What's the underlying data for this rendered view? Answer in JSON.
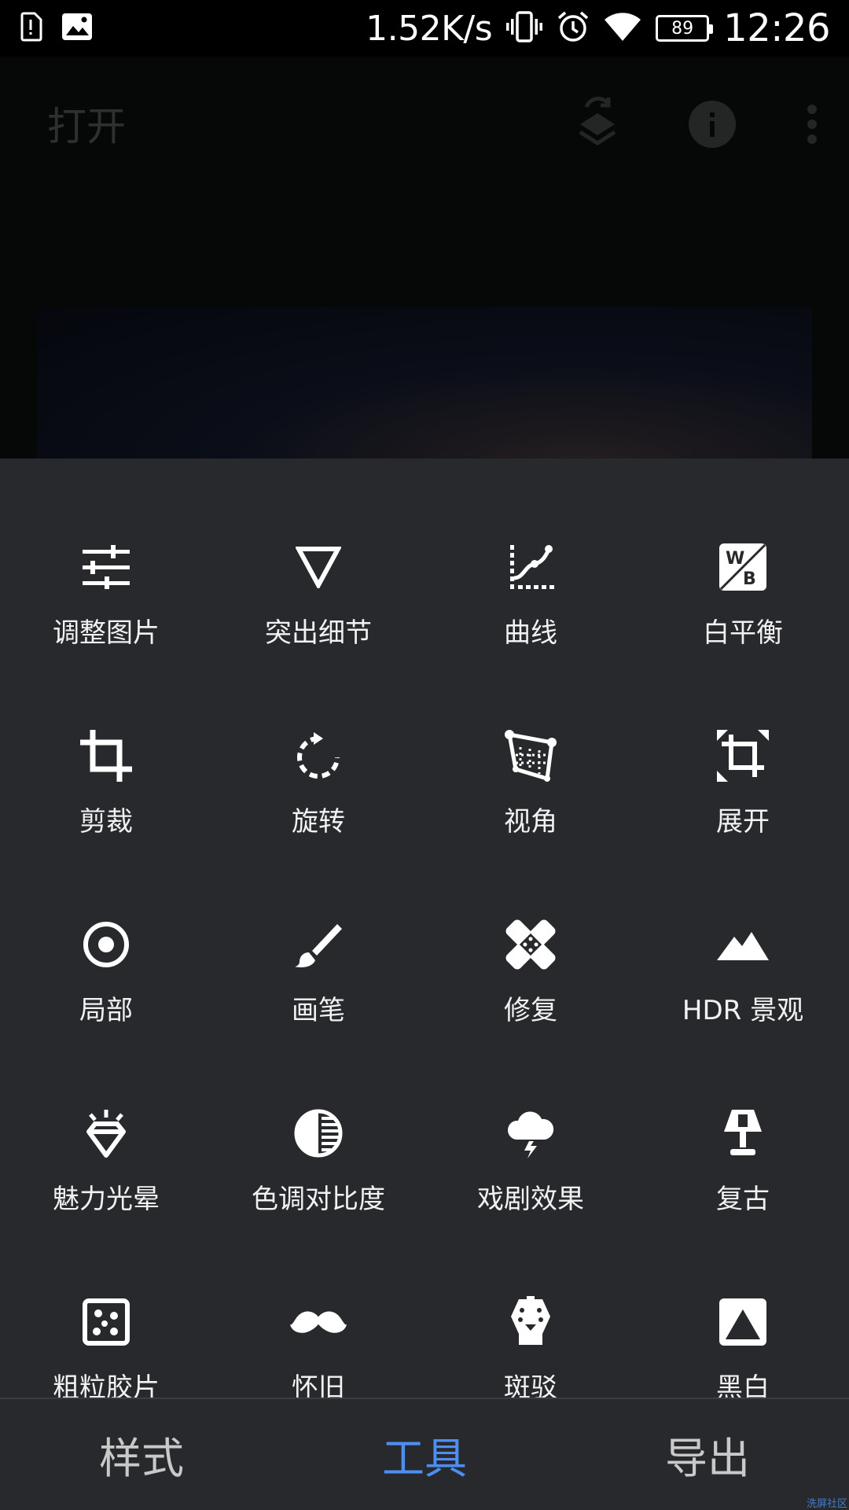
{
  "status_bar": {
    "net_speed": "1.52K/s",
    "battery": "89",
    "time": "12:26",
    "icons": [
      "alert-icon",
      "image-icon",
      "vibrate-icon",
      "alarm-icon",
      "wifi-icon",
      "battery-icon"
    ]
  },
  "app_bar": {
    "title": "打开",
    "actions": [
      "layers-undo-icon",
      "info-icon",
      "more-vert-icon"
    ]
  },
  "tools": [
    {
      "label": "调整图片",
      "icon": "tune-icon"
    },
    {
      "label": "突出细节",
      "icon": "details-triangle-icon"
    },
    {
      "label": "曲线",
      "icon": "curves-icon"
    },
    {
      "label": "白平衡",
      "icon": "white-balance-icon"
    },
    {
      "label": "剪裁",
      "icon": "crop-icon"
    },
    {
      "label": "旋转",
      "icon": "rotate-icon"
    },
    {
      "label": "视角",
      "icon": "perspective-icon"
    },
    {
      "label": "展开",
      "icon": "expand-icon"
    },
    {
      "label": "局部",
      "icon": "selective-icon"
    },
    {
      "label": "画笔",
      "icon": "brush-icon"
    },
    {
      "label": "修复",
      "icon": "healing-icon"
    },
    {
      "label": "HDR 景观",
      "icon": "hdr-mountain-icon"
    },
    {
      "label": "魅力光晕",
      "icon": "glamour-glow-icon"
    },
    {
      "label": "色调对比度",
      "icon": "tonal-contrast-icon"
    },
    {
      "label": "戏剧效果",
      "icon": "drama-icon"
    },
    {
      "label": "复古",
      "icon": "vintage-lamp-icon"
    },
    {
      "label": "粗粒胶片",
      "icon": "grainy-film-icon"
    },
    {
      "label": "怀旧",
      "icon": "retrolux-mustache-icon"
    },
    {
      "label": "斑驳",
      "icon": "grunge-guitar-icon"
    },
    {
      "label": "黑白",
      "icon": "black-white-icon"
    }
  ],
  "bottom_nav": {
    "tabs": [
      "样式",
      "工具",
      "导出"
    ],
    "active": "工具"
  },
  "watermark": "洗屏社区",
  "colors": {
    "sheet_bg": "#27292c",
    "accent": "#4d8ff0",
    "label": "#f2f2f2"
  }
}
